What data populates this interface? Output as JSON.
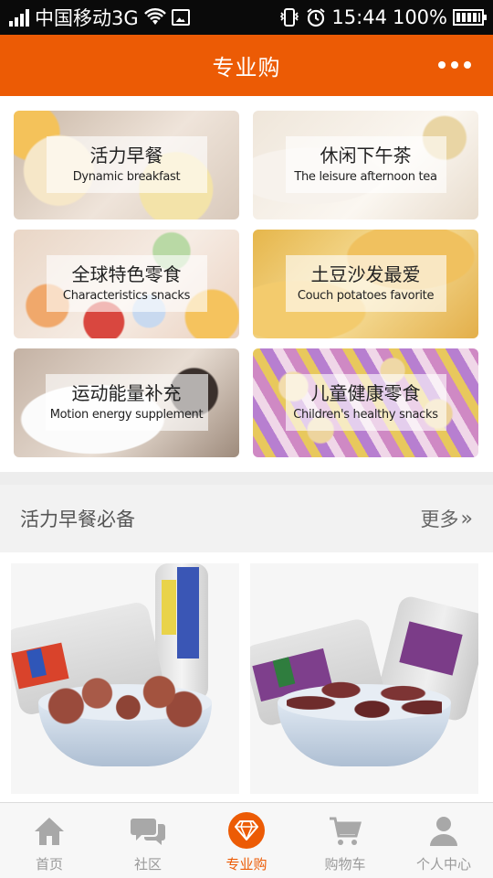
{
  "status_bar": {
    "carrier": "中国移动3G",
    "time": "15:44",
    "battery": "100%"
  },
  "header": {
    "title": "专业购"
  },
  "categories": [
    {
      "zh": "活力早餐",
      "en": "Dynamic breakfast"
    },
    {
      "zh": "休闲下午茶",
      "en": "The leisure afternoon tea"
    },
    {
      "zh": "全球特色零食",
      "en": "Characteristics snacks"
    },
    {
      "zh": "土豆沙发最爱",
      "en": "Couch potatoes favorite"
    },
    {
      "zh": "运动能量补充",
      "en": "Motion energy supplement"
    },
    {
      "zh": "儿童健康零食",
      "en": "Children's healthy snacks"
    }
  ],
  "section": {
    "title": "活力早餐必备",
    "more": "更多"
  },
  "products": [
    {
      "icon": "hawthorn-ball-jar-image"
    },
    {
      "icon": "prune-jar-image"
    }
  ],
  "bottom_nav": [
    {
      "label": "首页",
      "icon": "home-icon"
    },
    {
      "label": "社区",
      "icon": "chat-icon"
    },
    {
      "label": "专业购",
      "icon": "diamond-icon",
      "active": true
    },
    {
      "label": "购物车",
      "icon": "cart-icon"
    },
    {
      "label": "个人中心",
      "icon": "person-icon"
    }
  ],
  "colors": {
    "accent": "#ec5b05",
    "status_bar": "#0a0a0a",
    "nav_inactive": "#9a9a9a"
  }
}
